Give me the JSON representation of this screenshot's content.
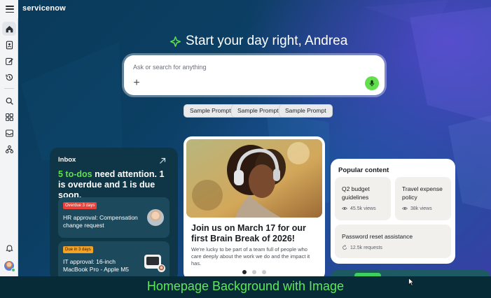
{
  "app": {
    "brand": "servicenow"
  },
  "sidebar": {
    "items": [
      {
        "icon": "home-icon",
        "active": true
      },
      {
        "icon": "id-card-icon"
      },
      {
        "icon": "edit-icon"
      },
      {
        "icon": "history-icon"
      },
      {
        "icon": "search-icon"
      },
      {
        "icon": "apps-grid-icon"
      },
      {
        "icon": "inbox-icon"
      },
      {
        "icon": "org-chart-icon"
      },
      {
        "icon": "bell-icon"
      }
    ]
  },
  "hero": {
    "greeting": "Start your day right, Andrea",
    "search_placeholder": "Ask or search for anything",
    "prompts": [
      "Sample Prompt",
      "Sample Prompt",
      "Sample Prompt"
    ]
  },
  "inbox": {
    "title": "Inbox",
    "headline_highlight": "5 to-dos",
    "headline_rest": " need attention. 1 is overdue and 1 is due soon.",
    "tasks": [
      {
        "badge": "Overdue 3 days",
        "text": "HR approval: Compensation change request"
      },
      {
        "badge": "Due in 3 days",
        "text": "IT approval: 16-inch MacBook Pro - Apple M5"
      }
    ]
  },
  "event": {
    "title": "Join us on March 17 for our first Brain Break of 2026!",
    "description": "We're lucky to be part of a team full of people who care deeply about the work we do and the impact it has."
  },
  "popular": {
    "title": "Popular content",
    "items": [
      {
        "title": "Q2 budget guidelines",
        "meta": "45.5k views",
        "meta_icon": "eye-icon"
      },
      {
        "title": "Travel expense policy",
        "meta": "38k views",
        "meta_icon": "eye-icon"
      },
      {
        "title": "Password reset assistance",
        "meta": "12.5k requests",
        "meta_icon": "requests-icon"
      }
    ]
  },
  "caption": "Homepage Background with Image",
  "colors": {
    "accent_green": "#63df4e",
    "inbox_bg": "#0f3646",
    "overdue_badge": "#e8413a",
    "due_soon_badge": "#f3a227",
    "caption_text": "#5ee85a"
  }
}
